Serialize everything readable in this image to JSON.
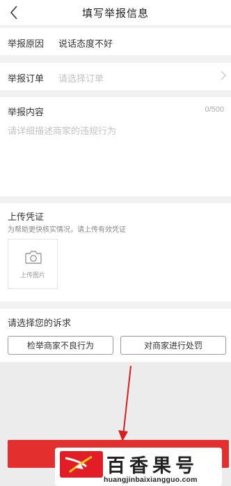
{
  "nav": {
    "title": "填写举报信息"
  },
  "reason": {
    "label": "举报原因",
    "value": "说话态度不好"
  },
  "order": {
    "label": "举报订单",
    "placeholder": "请选择订单"
  },
  "content": {
    "label": "举报内容",
    "counter": "0/500",
    "placeholder": "请详细描述商家的违规行为"
  },
  "evidence": {
    "title": "上传凭证",
    "hint": "为帮助更快核实情况，请上传有效凭证",
    "upload_label": "上传图片"
  },
  "appeal": {
    "title": "请选择您的诉求",
    "options": [
      "检举商家不良行为",
      "对商家进行处罚"
    ]
  },
  "watermark": {
    "brand": "百香果号",
    "domain": "huangjinbaixiangguo.com"
  },
  "colors": {
    "accent": "#e42f2f",
    "annotation_arrow": "#d81e1e"
  },
  "icons": {
    "back": "chevron-left-icon",
    "order_chevron": "chevron-right-icon",
    "upload": "camera-icon"
  }
}
